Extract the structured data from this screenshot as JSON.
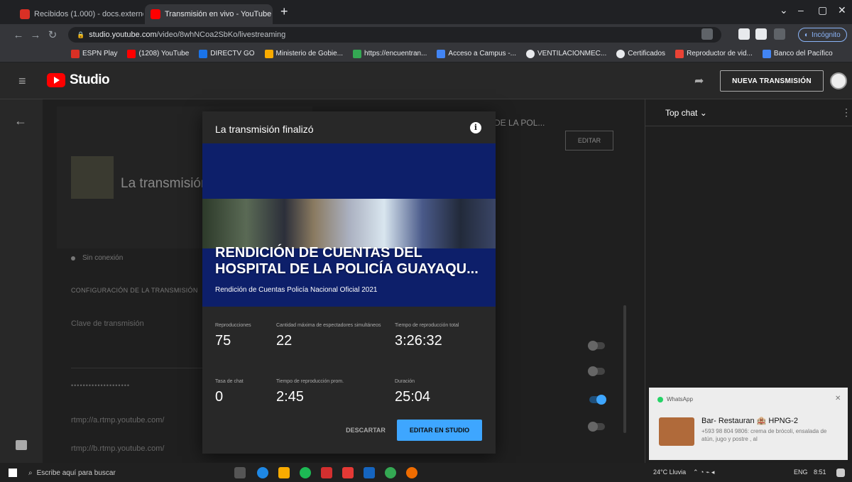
{
  "browser": {
    "tabs": [
      {
        "title": "Recibidos (1.000) - docs.externo",
        "favicon_color": "#d93025"
      },
      {
        "title": "Transmisión en vivo - YouTube S",
        "favicon_color": "#ff0000"
      }
    ],
    "url_host": "studio.youtube.com",
    "url_path": "/video/8whNCoa2SbKo/livestreaming",
    "incognito_label": "Incógnito",
    "bookmarks": [
      {
        "label": "ESPN Play",
        "color": "#d93025"
      },
      {
        "label": "(1208) YouTube",
        "color": "#ff0000"
      },
      {
        "label": "DIRECTV GO",
        "color": "#1a73e8"
      },
      {
        "label": "Ministerio de Gobie...",
        "color": "#f9ab00"
      },
      {
        "label": "https://encuentran...",
        "color": "#34a853"
      },
      {
        "label": "Acceso a Campus -...",
        "color": "#4285f4"
      },
      {
        "label": "VENTILACIONMEC...",
        "color": "#e8eaed"
      },
      {
        "label": "Certificados",
        "color": "#e8eaed"
      },
      {
        "label": "Reproductor de vid...",
        "color": "#ea4335"
      },
      {
        "label": "Banco del Pacífico",
        "color": "#4285f4"
      }
    ]
  },
  "studio": {
    "logo_text": "Studio",
    "new_stream_button": "NUEVA TRANSMISIÓN"
  },
  "background": {
    "preview_text": "La transmisión",
    "video_title_peek": "DE LA POL...",
    "edit_button": "EDITAR",
    "status": "Sin conexión",
    "config_label": "CONFIGURACIÓN DE LA TRANSMISIÓN",
    "stream_key_label": "Clave de transmisión",
    "masked_key": "••••••••••••••••••••",
    "rtmp1": "rtmp://a.rtmp.youtube.com/",
    "rtmp2": "rtmp://b.rtmp.youtube.com/"
  },
  "chat": {
    "top_chat": "Top chat ⌄"
  },
  "modal": {
    "title": "La transmisión finalizó",
    "banner_title": "RENDICIÓN DE CUENTAS DEL HOSPITAL DE LA POLICÍA GUAYAQU...",
    "banner_subtitle": "Rendición de Cuentas Policía Nacional Oficial 2021",
    "stats": [
      {
        "label": "Reproducciones",
        "value": "75"
      },
      {
        "label": "Cantidad máxima de espectadores simultáneos",
        "value": "22"
      },
      {
        "label": "Tiempo de reproducción total",
        "value": "3:26:32"
      },
      {
        "label": "Tasa de chat",
        "value": "0"
      },
      {
        "label": "Tiempo de reproducción prom.",
        "value": "2:45"
      },
      {
        "label": "Duración",
        "value": "25:04"
      }
    ],
    "dismiss_button": "DESCARTAR",
    "edit_studio_button": "EDITAR EN STUDIO"
  },
  "notification": {
    "app": "WhatsApp",
    "title": "Bar- Restauran 🏨 HPNG-2",
    "body": "+593 98 804 9806: crema de brócoli, ensalada de atún, jugo y postre , al"
  },
  "taskbar": {
    "search_placeholder": "Escribe aquí para buscar",
    "weather": "24°C Lluvia",
    "lang": "ENG",
    "time": "8:51"
  },
  "colors": {
    "accent": "#3ea6ff",
    "banner": "#0d1f6a",
    "youtube_red": "#ff0000"
  }
}
